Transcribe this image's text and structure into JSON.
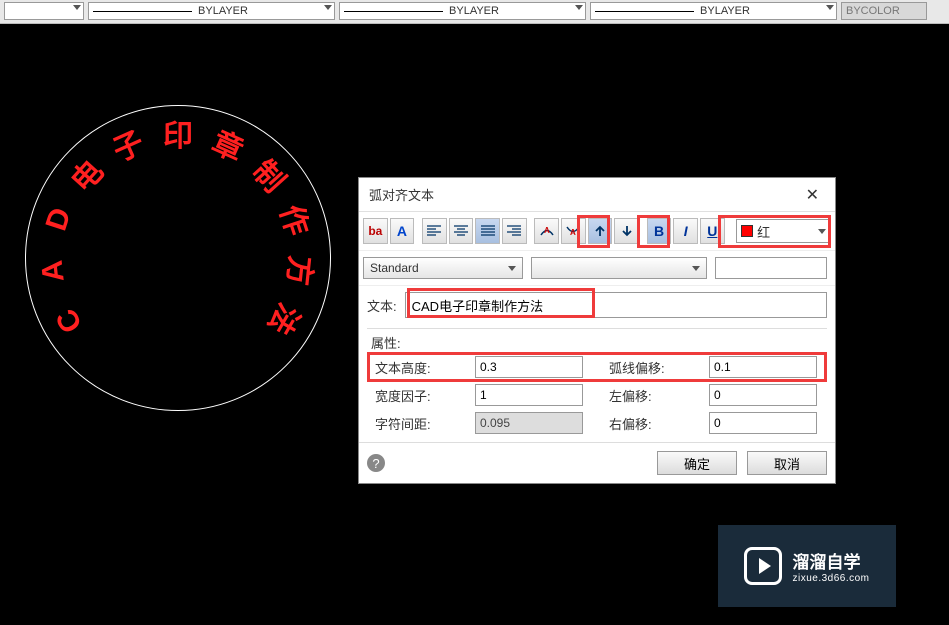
{
  "toolbar": {
    "combo2": "BYLAYER",
    "combo3": "BYLAYER",
    "combo4": "BYLAYER",
    "combo5": "BYCOLOR"
  },
  "stamp": {
    "text": "CAD电子印章制作方法"
  },
  "dialog": {
    "title": "弧对齐文本",
    "close": "✕",
    "tool_ba": "ba",
    "tool_A": "A",
    "tool_B": "B",
    "tool_I": "I",
    "tool_U": "U",
    "color_label": "红",
    "style_combo": "Standard",
    "text_label": "文本:",
    "text_value": "CAD电子印章制作方法",
    "props_label": "属性:",
    "props": {
      "text_height_label": "文本高度:",
      "text_height": "0.3",
      "arc_offset_label": "弧线偏移:",
      "arc_offset": "0.1",
      "width_factor_label": "宽度因子:",
      "width_factor": "1",
      "left_offset_label": "左偏移:",
      "left_offset": "0",
      "char_spacing_label": "字符间距:",
      "char_spacing": "0.095",
      "right_offset_label": "右偏移:",
      "right_offset": "0"
    },
    "ok": "确定",
    "cancel": "取消",
    "help": "?"
  },
  "watermark": {
    "line1": "溜溜自学",
    "line2": "zixue.3d66.com"
  }
}
